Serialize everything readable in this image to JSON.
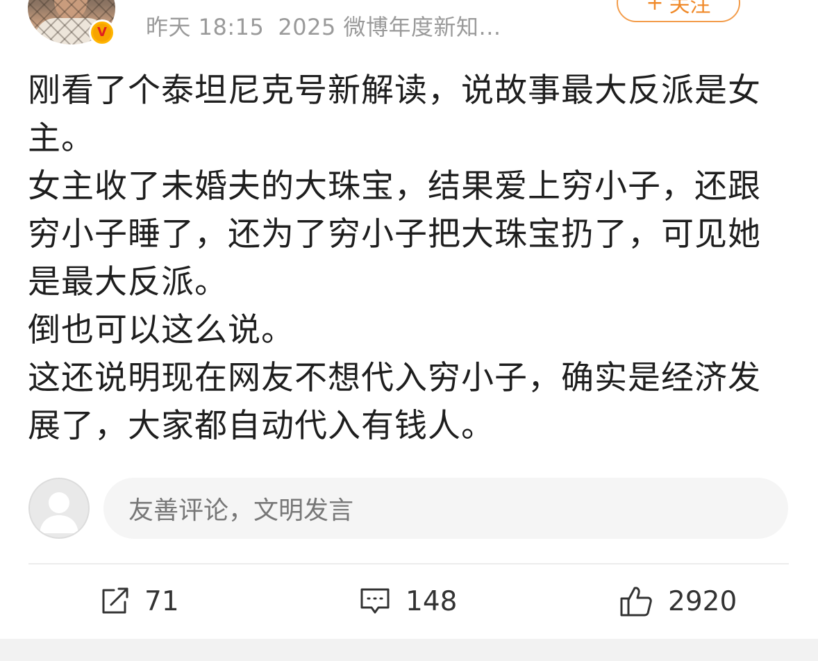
{
  "header": {
    "timestamp": "昨天 18:15",
    "source": "2025 微博年度新知...",
    "follow_label": "关注",
    "follow_plus": "+",
    "verified_badge_letter": "V"
  },
  "post": {
    "paragraphs": [
      "刚看了个泰坦尼克号新解读，说故事最大反派是女主。",
      "女主收了未婚夫的大珠宝，结果爱上穷小子，还跟穷小子睡了，还为了穷小子把大珠宝扔了，可见她是最大反派。",
      "倒也可以这么说。",
      "这还说明现在网友不想代入穷小子，确实是经济发展了，大家都自动代入有钱人。"
    ]
  },
  "comment_box": {
    "placeholder": "友善评论，文明发言"
  },
  "actions": {
    "share_count": "71",
    "comment_count": "148",
    "like_count": "2920"
  },
  "colors": {
    "accent_orange": "#f08a2a",
    "meta_gray": "#9a9a9a",
    "badge_yellow": "#ffb400"
  },
  "icons": {
    "share": "share-icon",
    "comment": "comment-icon",
    "like": "thumbs-up-icon",
    "verified": "verified-badge-icon",
    "default_avatar": "default-avatar-icon"
  }
}
